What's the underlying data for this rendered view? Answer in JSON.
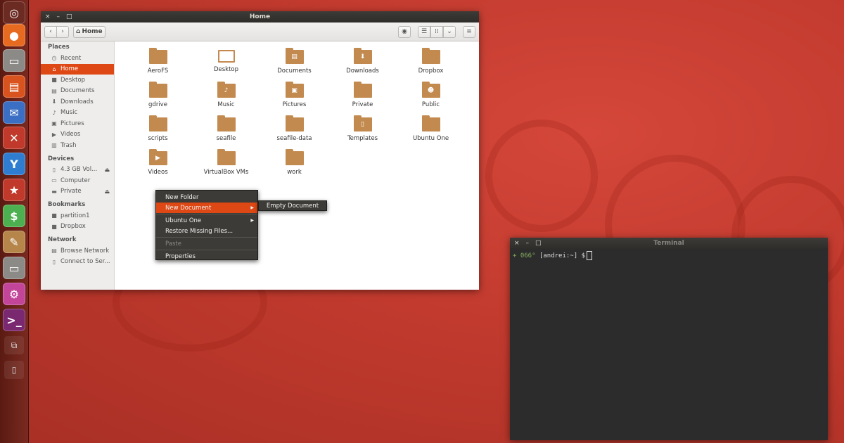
{
  "launcher": {
    "icons": [
      "ubuntu-logo-icon",
      "firefox-icon",
      "files-icon",
      "software-center-icon",
      "messaging-icon",
      "tools-icon",
      "yahoo-icon",
      "bookmark-icon",
      "money-icon",
      "text-editor-icon",
      "files-icon",
      "settings-icon",
      "terminal-icon",
      "workspaces-icon",
      "device-icon"
    ]
  },
  "files_window": {
    "title": "Home",
    "controls": {
      "close": "×",
      "minimize": "–",
      "maximize": "□"
    },
    "location": "Home",
    "sidebar": {
      "places_header": "Places",
      "places": [
        "Recent",
        "Home",
        "Desktop",
        "Documents",
        "Downloads",
        "Music",
        "Pictures",
        "Videos",
        "Trash"
      ],
      "devices_header": "Devices",
      "devices": [
        "4.3 GB Vol...",
        "Computer",
        "Private"
      ],
      "bookmarks_header": "Bookmarks",
      "bookmarks": [
        "partition1",
        "Dropbox"
      ],
      "network_header": "Network",
      "network": [
        "Browse Network",
        "Connect to Ser..."
      ]
    },
    "files": [
      {
        "name": "AeroFS",
        "glyph": ""
      },
      {
        "name": "Desktop",
        "glyph": ""
      },
      {
        "name": "Documents",
        "glyph": "▤"
      },
      {
        "name": "Downloads",
        "glyph": "⬇"
      },
      {
        "name": "Dropbox",
        "glyph": ""
      },
      {
        "name": "gdrive",
        "glyph": ""
      },
      {
        "name": "Music",
        "glyph": "♪"
      },
      {
        "name": "Pictures",
        "glyph": "▣"
      },
      {
        "name": "Private",
        "glyph": ""
      },
      {
        "name": "Public",
        "glyph": "☻"
      },
      {
        "name": "scripts",
        "glyph": ""
      },
      {
        "name": "seafile",
        "glyph": ""
      },
      {
        "name": "seafile-data",
        "glyph": ""
      },
      {
        "name": "Templates",
        "glyph": "▯"
      },
      {
        "name": "Ubuntu One",
        "glyph": ""
      },
      {
        "name": "Videos",
        "glyph": "▶"
      },
      {
        "name": "VirtualBox VMs",
        "glyph": ""
      },
      {
        "name": "work",
        "glyph": ""
      }
    ]
  },
  "context_menu": {
    "new_folder": "New Folder",
    "new_document": "New Document",
    "ubuntu_one": "Ubuntu One",
    "restore": "Restore Missing Files...",
    "paste": "Paste",
    "properties": "Properties",
    "submenu_empty_document": "Empty Document"
  },
  "terminal": {
    "title": "Terminal",
    "prompt_marker": "+ 066°",
    "prompt_user": "[andrei:~] $"
  },
  "colors": {
    "accent": "#dd4814",
    "folder": "#c38a4f",
    "titlebar": "#3c3b37"
  }
}
